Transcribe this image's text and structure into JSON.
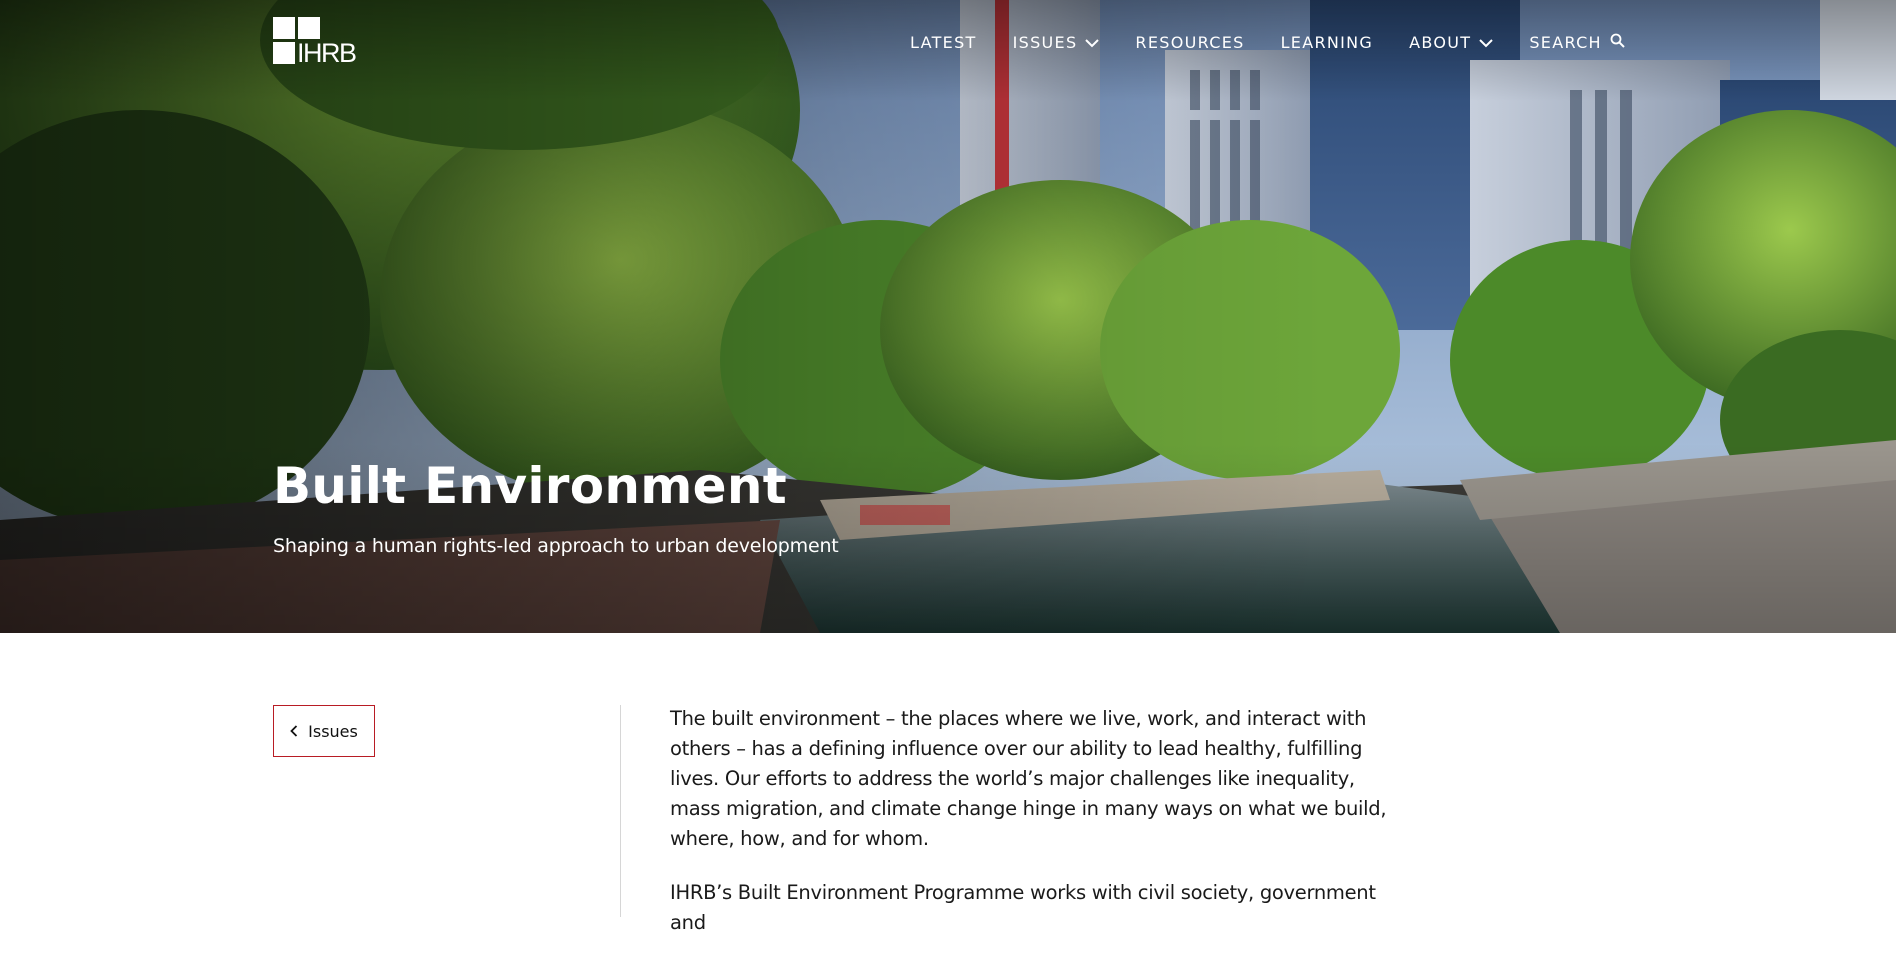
{
  "logo": {
    "text": "IHRB"
  },
  "nav": {
    "items": [
      {
        "label": "LATEST",
        "has_dropdown": false
      },
      {
        "label": "ISSUES",
        "has_dropdown": true
      },
      {
        "label": "RESOURCES",
        "has_dropdown": false
      },
      {
        "label": "LEARNING",
        "has_dropdown": false
      },
      {
        "label": "ABOUT",
        "has_dropdown": true
      },
      {
        "label": "SEARCH",
        "has_dropdown": false,
        "icon": "search-icon"
      }
    ]
  },
  "hero": {
    "title": "Built Environment",
    "subtitle": "Shaping a human rights-led approach to urban development"
  },
  "back_button": {
    "label": "Issues",
    "icon": "chevron-left-icon"
  },
  "article": {
    "paragraphs": [
      "The built environment – the places where we live, work, and interact with others – has a defining influence over our ability to lead healthy, fulfilling lives. Our efforts to address the world’s major challenges like inequality, mass migration, and climate change hinge in many ways on what we build, where, how, and for whom.",
      "IHRB’s Built Environment Programme works with civil society, government and"
    ]
  },
  "colors": {
    "accent": "#b81c24",
    "text": "#1a1a1a",
    "hero_overlay_text": "#ffffff"
  }
}
